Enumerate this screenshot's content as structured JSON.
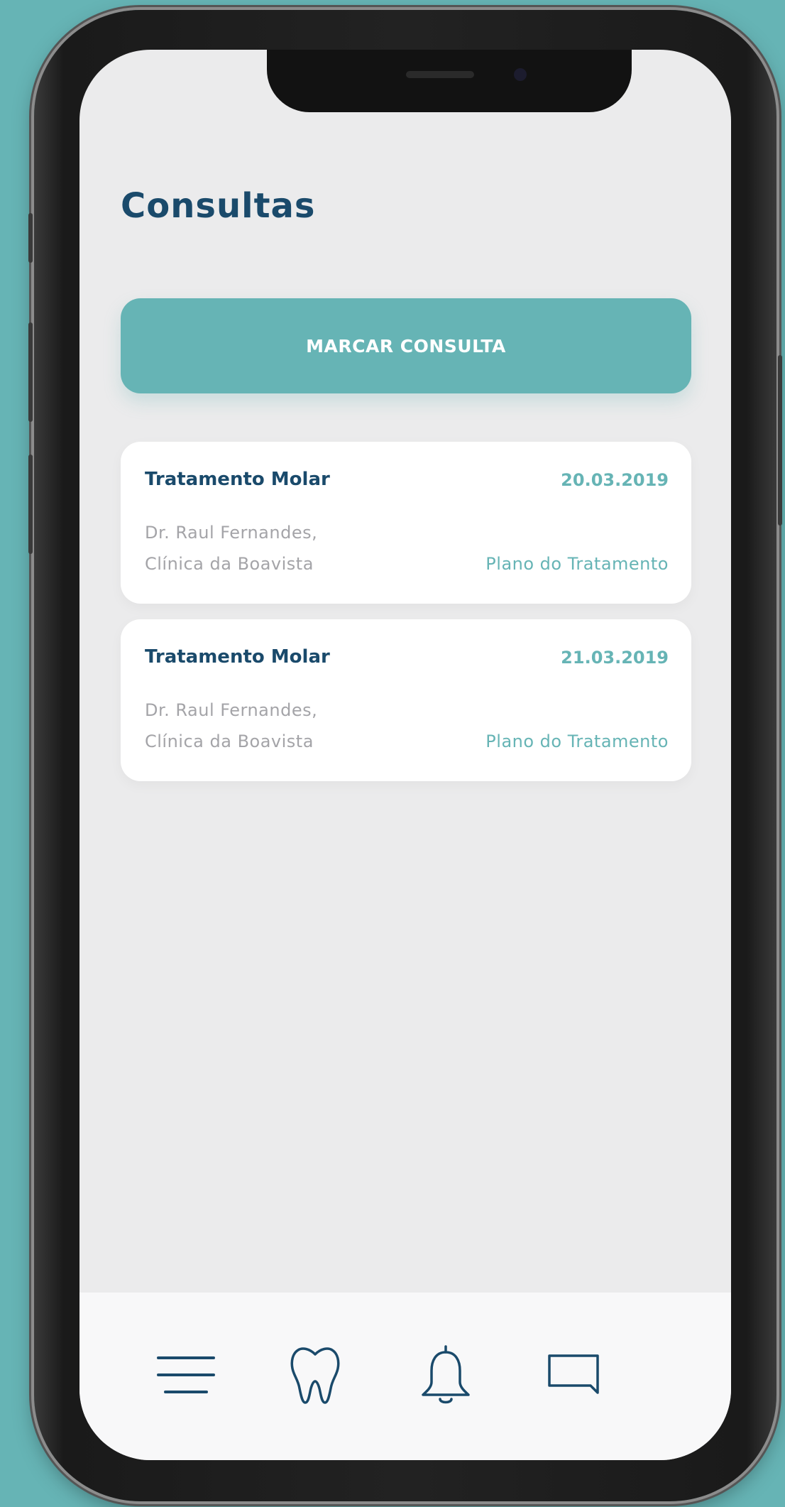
{
  "page": {
    "title": "Consultas"
  },
  "actions": {
    "book_label": "MARCAR CONSULTA"
  },
  "appointments": [
    {
      "title": "Tratamento Molar",
      "date": "20.03.2019",
      "doctor": "Dr. Raul Fernandes,",
      "clinic": "Clínica da Boavista",
      "link": "Plano do Tratamento"
    },
    {
      "title": "Tratamento Molar",
      "date": "21.03.2019",
      "doctor": "Dr. Raul Fernandes,",
      "clinic": "Clínica da Boavista",
      "link": "Plano do Tratamento"
    }
  ],
  "tabbar": {
    "items": [
      {
        "icon": "menu-icon"
      },
      {
        "icon": "tooth-icon"
      },
      {
        "icon": "bell-icon"
      },
      {
        "icon": "chat-icon"
      }
    ]
  },
  "colors": {
    "background": "#66b4b5",
    "accent": "#66b4b5",
    "title": "#1a4a6b",
    "muted_text": "#a4a4a8",
    "screen": "#ebebec",
    "card": "#ffffff"
  }
}
